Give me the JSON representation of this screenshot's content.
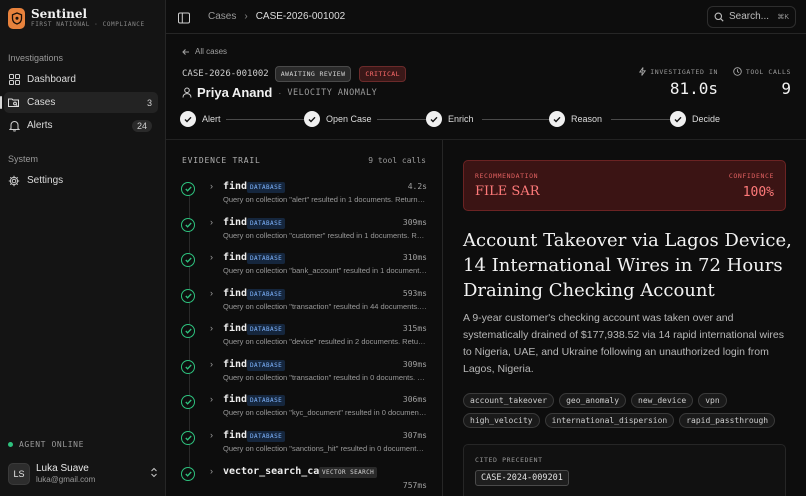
{
  "brand": {
    "name": "Sentinel",
    "subtitle": "FIRST NATIONAL · COMPLIANCE"
  },
  "sidebar": {
    "sections": [
      {
        "title": "Investigations",
        "items": [
          {
            "label": "Dashboard",
            "count": ""
          },
          {
            "label": "Cases",
            "count": "3"
          },
          {
            "label": "Alerts",
            "count": "24"
          }
        ]
      },
      {
        "title": "System",
        "items": [
          {
            "label": "Settings",
            "count": ""
          }
        ]
      }
    ],
    "agent_status": "AGENT ONLINE",
    "user": {
      "initials": "LS",
      "name": "Luka Suave",
      "email": "luka@gmail.com"
    }
  },
  "topbar": {
    "crumb_root": "Cases",
    "crumb_current": "CASE-2026-001002",
    "search_placeholder": "Search...",
    "search_shortcut": "⌘K"
  },
  "case": {
    "back_label": "All cases",
    "id": "CASE-2026-001002",
    "status_badge": "AWAITING REVIEW",
    "severity_badge": "CRITICAL",
    "person_name": "Priya Anand",
    "case_type": "VELOCITY ANOMALY",
    "investigated_label": "INVESTIGATED IN",
    "investigated_value": "81.0s",
    "tool_calls_label": "TOOL CALLS",
    "tool_calls_value": "9"
  },
  "steps": [
    "Alert",
    "Open Case",
    "Enrich",
    "Reason",
    "Decide"
  ],
  "evidence": {
    "title": "EVIDENCE TRAIL",
    "count": "9 tool calls",
    "items": [
      {
        "name": "find",
        "tag": "DATABASE",
        "time": "4.2s",
        "desc": "Query on collection \"alert\" resulted in 1 documents. Returned fields: alert_id, customer_id"
      },
      {
        "name": "find",
        "tag": "DATABASE",
        "time": "309ms",
        "desc": "Query on collection \"customer\" resulted in 1 documents. Returned fields"
      },
      {
        "name": "find",
        "tag": "DATABASE",
        "time": "310ms",
        "desc": "Query on collection \"bank_account\" resulted in 1 documents. Returned fields"
      },
      {
        "name": "find",
        "tag": "DATABASE",
        "time": "593ms",
        "desc": "Query on collection \"transaction\" resulted in 44 documents. Returned fields"
      },
      {
        "name": "find",
        "tag": "DATABASE",
        "time": "315ms",
        "desc": "Query on collection \"device\" resulted in 2 documents. Returned fields"
      },
      {
        "name": "find",
        "tag": "DATABASE",
        "time": "309ms",
        "desc": "Query on collection \"transaction\" resulted in 0 documents. Returned fields"
      },
      {
        "name": "find",
        "tag": "DATABASE",
        "time": "306ms",
        "desc": "Query on collection \"kyc_document\" resulted in 0 documents. Returned fields"
      },
      {
        "name": "find",
        "tag": "DATABASE",
        "time": "307ms",
        "desc": "Query on collection \"sanctions_hit\" resulted in 0 documents. Returned fields"
      },
      {
        "name": "vector_search_cases",
        "tag": "VECTOR SEARCH",
        "time": "757ms",
        "desc": ""
      }
    ]
  },
  "recommendation": {
    "label": "RECOMMENDATION",
    "value": "FILE SAR",
    "confidence_label": "CONFIDENCE",
    "confidence_value": "100%"
  },
  "headline": "Account Takeover via Lagos Device, 14 International Wires in 72 Hours Draining Checking Account",
  "summary": "A 9-year customer's checking account was taken over and systematically drained of $177,938.52 via 14 rapid international wires to Nigeria, UAE, and Ukraine following an unauthorized login from Lagos, Nigeria.",
  "tags": [
    "account_takeover",
    "geo_anomaly",
    "new_device",
    "vpn",
    "high_velocity",
    "international_dispersion",
    "rapid_passthrough"
  ],
  "cited": {
    "label": "CITED PRECEDENT",
    "case_id": "CASE-2024-009201"
  }
}
